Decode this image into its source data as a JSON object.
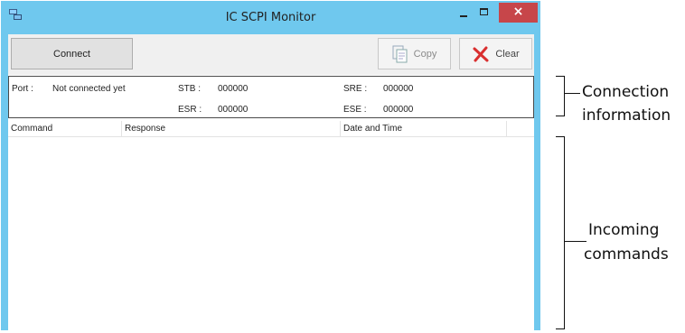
{
  "window": {
    "title": "IC SCPI Monitor",
    "close_glyph": "×"
  },
  "toolbar": {
    "connect_label": "Connect",
    "copy_label": "Copy",
    "clear_label": "Clear"
  },
  "info": {
    "port_label": "Port :",
    "port_value": "Not connected yet",
    "stb_label": "STB :",
    "stb_value": "000000",
    "sre_label": "SRE :",
    "sre_value": "000000",
    "esr_label": "ESR :",
    "esr_value": "000000",
    "ese_label": "ESE :",
    "ese_value": "000000"
  },
  "table": {
    "columns": [
      "Command",
      "Response",
      "Date and Time"
    ],
    "rows": []
  },
  "annotations": {
    "connection_line1": "Connection",
    "connection_line2": "information",
    "incoming_line1": "Incoming",
    "incoming_line2": "commands"
  },
  "colors": {
    "titlebar": "#6fc8ee",
    "close_button": "#c7464a",
    "clear_x": "#d92f2f"
  },
  "icons": [
    "app-network-icon",
    "minimize-icon",
    "maximize-icon",
    "close-icon",
    "copy-icon",
    "clear-x-icon"
  ]
}
